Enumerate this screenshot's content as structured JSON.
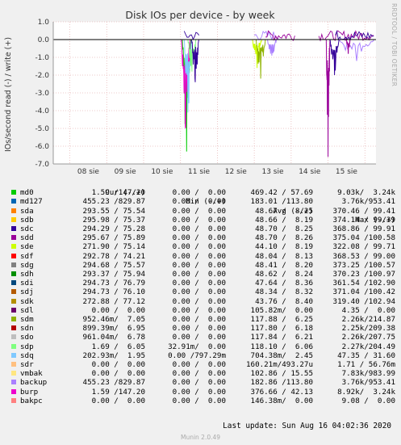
{
  "chart_data": {
    "type": "line",
    "title": "Disk IOs per device - by week",
    "ylabel": "IOs/second read (-) / write (+)",
    "ylim": [
      -7.0,
      1.0
    ],
    "yticks": [
      "1.0",
      "0.0",
      "-1.0",
      "-2.0",
      "-3.0",
      "-4.0",
      "-5.0",
      "-6.0",
      "-7.0"
    ],
    "xtick_labels": [
      "08 sie",
      "09 sie",
      "10 sie",
      "11 sie",
      "12 sie",
      "13 sie",
      "14 sie",
      "15 sie"
    ],
    "x_range_days": [
      7.55,
      16.3
    ],
    "grid": true,
    "columns": [
      "Cur (-/+)",
      "Min (-/+)",
      "Avg (-/+)",
      "Max (-/+)"
    ],
    "series": [
      {
        "name": "md0",
        "color": "#00cc00",
        "cur": "1.59 /147.20",
        "min": "0.00 /  0.00",
        "avg": "469.42 / 57.69",
        "max": "9.03k/  3.24k"
      },
      {
        "name": "md127",
        "color": "#0066b3",
        "cur": "455.23 /829.87",
        "min": "0.00 /  0.00",
        "avg": "183.01 /113.80",
        "max": "3.76k/953.41"
      },
      {
        "name": "sda",
        "color": "#ff8000",
        "cur": "293.55 / 75.54",
        "min": "0.00 /  0.00",
        "avg": "48.67 /  8.25",
        "max": "370.46 / 99.41"
      },
      {
        "name": "sdb",
        "color": "#ffcc00",
        "cur": "295.98 / 75.37",
        "min": "0.00 /  0.00",
        "avg": "48.66 /  8.19",
        "max": "374.14 / 99.39"
      },
      {
        "name": "sdc",
        "color": "#330099",
        "cur": "294.29 / 75.28",
        "min": "0.00 /  0.00",
        "avg": "48.70 /  8.25",
        "max": "368.86 / 99.91"
      },
      {
        "name": "sdd",
        "color": "#990099",
        "cur": "295.67 / 75.89",
        "min": "0.00 /  0.00",
        "avg": "48.70 /  8.26",
        "max": "375.04 /100.58"
      },
      {
        "name": "sde",
        "color": "#ccff00",
        "cur": "271.90 / 75.14",
        "min": "0.00 /  0.00",
        "avg": "44.10 /  8.19",
        "max": "322.08 / 99.71"
      },
      {
        "name": "sdf",
        "color": "#ff0000",
        "cur": "292.78 / 74.21",
        "min": "0.00 /  0.00",
        "avg": "48.04 /  8.13",
        "max": "368.53 / 99.00"
      },
      {
        "name": "sdg",
        "color": "#808080",
        "cur": "294.68 / 75.57",
        "min": "0.00 /  0.00",
        "avg": "48.41 /  8.20",
        "max": "373.25 /100.57"
      },
      {
        "name": "sdh",
        "color": "#008f00",
        "cur": "293.37 / 75.94",
        "min": "0.00 /  0.00",
        "avg": "48.62 /  8.24",
        "max": "370.23 /100.97"
      },
      {
        "name": "sdi",
        "color": "#00487d",
        "cur": "294.73 / 76.79",
        "min": "0.00 /  0.00",
        "avg": "47.64 /  8.36",
        "max": "361.54 /102.90"
      },
      {
        "name": "sdj",
        "color": "#b35a00",
        "cur": "294.73 / 76.10",
        "min": "0.00 /  0.00",
        "avg": "48.34 /  8.32",
        "max": "371.04 /100.42"
      },
      {
        "name": "sdk",
        "color": "#b38f00",
        "cur": "272.88 / 77.12",
        "min": "0.00 /  0.00",
        "avg": "43.76 /  8.40",
        "max": "319.40 /102.94"
      },
      {
        "name": "sdl",
        "color": "#6b006b",
        "cur": "0.00 /  0.00",
        "min": "0.00 /  0.00",
        "avg": "105.82m/  0.00",
        "max": "4.35 /  0.00"
      },
      {
        "name": "sdm",
        "color": "#8fb300",
        "cur": "952.46m/  7.05",
        "min": "0.00 /  0.00",
        "avg": "117.88 /  6.25",
        "max": "2.26k/214.87"
      },
      {
        "name": "sdn",
        "color": "#b30000",
        "cur": "899.39m/  6.95",
        "min": "0.00 /  0.00",
        "avg": "117.80 /  6.18",
        "max": "2.25k/209.38"
      },
      {
        "name": "sdo",
        "color": "#bebebe",
        "cur": "961.04m/  6.78",
        "min": "0.00 /  0.00",
        "avg": "117.84 /  6.21",
        "max": "2.26k/207.75"
      },
      {
        "name": "sdp",
        "color": "#80ff80",
        "cur": "1.69 /  6.05",
        "min": "32.91m/  0.00",
        "avg": "118.10 /  6.06",
        "max": "2.27k/204.49"
      },
      {
        "name": "sdq",
        "color": "#80c9ff",
        "cur": "202.93m/  1.95",
        "min": "0.00 /797.29m",
        "avg": "704.38m/  2.45",
        "max": "47.35 / 31.60"
      },
      {
        "name": "sdr",
        "color": "#ffc080",
        "cur": "0.00 /  0.00",
        "min": "0.00 /  0.00",
        "avg": "160.21m/493.27u",
        "max": "1.71 / 56.76m"
      },
      {
        "name": "vmbak",
        "color": "#ffe680",
        "cur": "0.00 /  0.00",
        "min": "0.00 /  0.00",
        "avg": "102.86 / 15.55",
        "max": "7.83k/983.99"
      },
      {
        "name": "backup",
        "color": "#aa80ff",
        "cur": "455.23 /829.87",
        "min": "0.00 /  0.00",
        "avg": "182.86 /113.80",
        "max": "3.76k/953.41"
      },
      {
        "name": "burp",
        "color": "#ee00cc",
        "cur": "1.59 /147.20",
        "min": "0.00 /  0.00",
        "avg": "376.66 / 42.13",
        "max": "8.92k/  3.24k"
      },
      {
        "name": "bakpc",
        "color": "#ff8080",
        "cur": "0.00 /  0.00",
        "min": "0.00 /  0.00",
        "avg": "146.38m/  0.00",
        "max": "9.08 /  0.00"
      }
    ],
    "bursts": [
      {
        "series": "md0",
        "start": 11.05,
        "end": 11.28,
        "min": -6.3
      },
      {
        "series": "burp",
        "start": 11.02,
        "end": 11.26,
        "min": -5.0
      },
      {
        "series": "sdq",
        "start": 11.1,
        "end": 11.3,
        "min": -4.1
      },
      {
        "series": "sdp",
        "start": 11.2,
        "end": 11.42,
        "min": -1.8
      },
      {
        "series": "sdc",
        "start": 11.3,
        "end": 11.5,
        "min": -2.4
      },
      {
        "series": "sde",
        "start": 12.95,
        "end": 13.2,
        "min": -1.6
      },
      {
        "series": "sdm",
        "start": 13.05,
        "end": 13.3,
        "min": -2.2
      },
      {
        "series": "backup",
        "start": 13.35,
        "end": 13.6,
        "min": -0.9
      },
      {
        "series": "sdd",
        "start": 14.95,
        "end": 15.05,
        "min": -6.6
      },
      {
        "series": "sdc",
        "start": 15.05,
        "end": 15.3,
        "min": -2.0
      },
      {
        "series": "backup",
        "start": 15.3,
        "end": 16.25,
        "min": -1.2
      },
      {
        "series": "sdd",
        "start": 15.5,
        "end": 15.6,
        "min": -0.8
      }
    ]
  },
  "legend_headers": {
    "cur": "Cur (-/+)",
    "min": "Min (-/+)",
    "avg": "Avg (-/+)",
    "max": "Max (-/+)"
  },
  "footer": "Last update: Sun Aug 16 04:02:36 2020",
  "version": "Munin 2.0.49",
  "side_label": "RRDTOOL / TOBI OETIKER"
}
